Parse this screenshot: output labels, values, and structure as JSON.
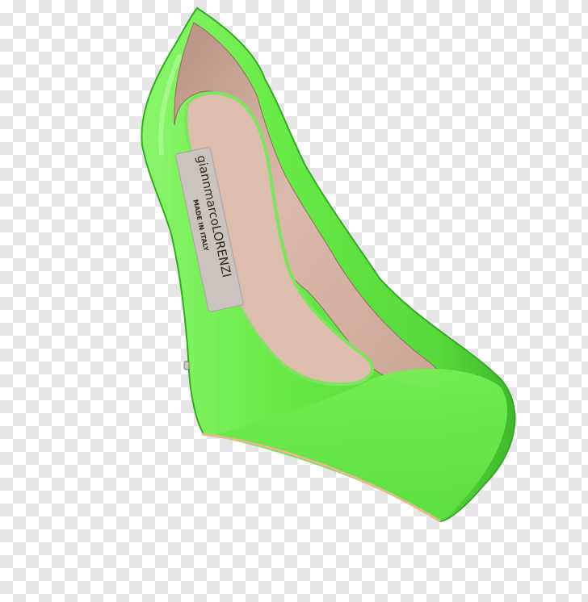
{
  "image": {
    "subject": "shoe",
    "background": "transparency-checkerboard",
    "colors": {
      "upper": "#66ec46",
      "upper_shadow": "#3fb82b",
      "upper_highlight": "#a6ff8c",
      "lining": "#d8b5a6",
      "lining_shadow": "#a98677",
      "label": "#c8c2bd",
      "sole_edge": "#e7b88b"
    }
  },
  "insole_label": {
    "brand": "giannmarcoLORENZI",
    "subtext": "MADE IN ITALY"
  }
}
